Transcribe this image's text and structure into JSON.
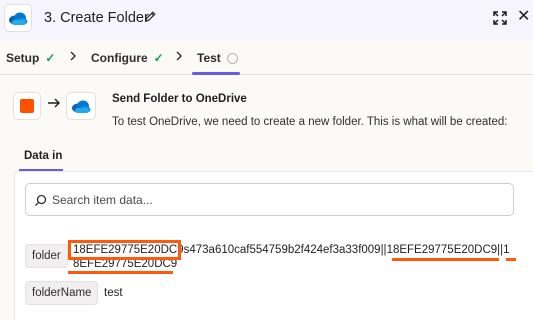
{
  "header": {
    "title": "3. Create Folder",
    "expand_icon": "expand-icon",
    "close_label": "✕"
  },
  "steps": [
    {
      "label": "Setup",
      "status": "complete"
    },
    {
      "label": "Configure",
      "status": "complete"
    },
    {
      "label": "Test",
      "status": "active"
    }
  ],
  "flow": {
    "title": "Send Folder to OneDrive",
    "description": "To test OneDrive, we need to create a new folder. This is what will be created:"
  },
  "tabs": {
    "data_in": "Data in"
  },
  "search": {
    "placeholder": "Search item data..."
  },
  "fields": [
    {
      "key": "folder",
      "value_line1_part1": "18EFE29775E20DC9",
      "value_line1_part2": "s473a610caf554759b2f424ef3a33f009||",
      "value_line1_part3": "18EFE29775E20DC9",
      "value_line1_part4": "||1",
      "value_line2": "8EFE29775E20DC9"
    },
    {
      "key": "folderName",
      "value": "test"
    }
  ],
  "colors": {
    "accent": "#695be8",
    "highlight": "#ff5a0a",
    "zapier_orange": "#ff4f00",
    "success": "#1f9c4e"
  }
}
